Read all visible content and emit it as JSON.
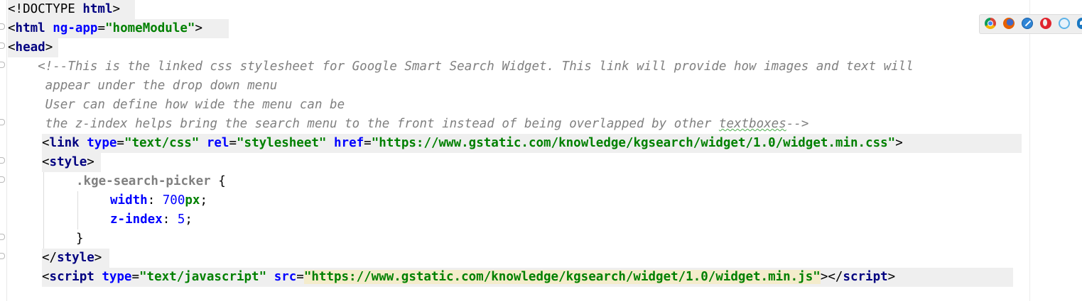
{
  "editor": {
    "lines": [
      {
        "segments": [
          {
            "t": "<!DOCTYPE ",
            "c": "doc"
          },
          {
            "t": "html",
            "c": "doc-kw"
          },
          {
            "t": ">",
            "c": "doc"
          }
        ]
      },
      {
        "segments": [
          {
            "t": "<",
            "c": "punc"
          },
          {
            "t": "html",
            "c": "name"
          },
          {
            "t": " ",
            "c": "punc"
          },
          {
            "t": "ng-app",
            "c": "attr"
          },
          {
            "t": "=",
            "c": "punc"
          },
          {
            "t": "\"homeModule\"",
            "c": "val"
          },
          {
            "t": ">",
            "c": "punc"
          }
        ]
      },
      {
        "segments": [
          {
            "t": "<",
            "c": "punc"
          },
          {
            "t": "head",
            "c": "name"
          },
          {
            "t": ">",
            "c": "punc"
          }
        ]
      },
      {
        "segments": [
          {
            "t": "    <!--This is the linked css stylesheet for Google Smart Search Widget. This link will provide how images and text will",
            "c": "comment"
          }
        ]
      },
      {
        "segments": [
          {
            "t": "     appear under the drop down menu",
            "c": "comment"
          }
        ]
      },
      {
        "segments": [
          {
            "t": "     User can define how wide the menu can be",
            "c": "comment"
          }
        ]
      },
      {
        "segments": [
          {
            "t": "     the z-index helps bring the search menu to the front instead of being overlapped by other ",
            "c": "comment"
          },
          {
            "t": "textboxes",
            "c": "comment-sq"
          },
          {
            "t": "-->",
            "c": "comment"
          }
        ]
      },
      {
        "segments": [
          {
            "t": "<",
            "c": "punc"
          },
          {
            "t": "link",
            "c": "name"
          },
          {
            "t": " ",
            "c": "punc"
          },
          {
            "t": "type",
            "c": "attr"
          },
          {
            "t": "=",
            "c": "punc"
          },
          {
            "t": "\"text/css\"",
            "c": "val"
          },
          {
            "t": " ",
            "c": "punc"
          },
          {
            "t": "rel",
            "c": "attr"
          },
          {
            "t": "=",
            "c": "punc"
          },
          {
            "t": "\"stylesheet\"",
            "c": "val"
          },
          {
            "t": " ",
            "c": "punc"
          },
          {
            "t": "href",
            "c": "attr"
          },
          {
            "t": "=",
            "c": "punc"
          },
          {
            "t": "\"https://www.gstatic.com/knowledge/kgsearch/widget/1.0/widget.min.css\"",
            "c": "val"
          },
          {
            "t": ">",
            "c": "punc"
          }
        ]
      },
      {
        "segments": [
          {
            "t": "<",
            "c": "punc"
          },
          {
            "t": "style",
            "c": "name"
          },
          {
            "t": ">",
            "c": "punc"
          }
        ]
      },
      {
        "segments": [
          {
            "t": ".kge-search-picker",
            "c": "css-sel"
          },
          {
            "t": " {",
            "c": "punc"
          }
        ]
      },
      {
        "segments": [
          {
            "t": "width",
            "c": "css-prop"
          },
          {
            "t": ": ",
            "c": "punc"
          },
          {
            "t": "700",
            "c": "css-num"
          },
          {
            "t": "px",
            "c": "css-unit"
          },
          {
            "t": ";",
            "c": "punc"
          }
        ]
      },
      {
        "segments": [
          {
            "t": "z-index",
            "c": "css-prop"
          },
          {
            "t": ": ",
            "c": "punc"
          },
          {
            "t": "5",
            "c": "css-num"
          },
          {
            "t": ";",
            "c": "punc"
          }
        ]
      },
      {
        "segments": [
          {
            "t": "}",
            "c": "punc"
          }
        ]
      },
      {
        "segments": [
          {
            "t": "</",
            "c": "punc"
          },
          {
            "t": "style",
            "c": "name"
          },
          {
            "t": ">",
            "c": "punc"
          }
        ]
      },
      {
        "segments": [
          {
            "t": "<",
            "c": "punc"
          },
          {
            "t": "script",
            "c": "name"
          },
          {
            "t": " ",
            "c": "punc"
          },
          {
            "t": "type",
            "c": "attr"
          },
          {
            "t": "=",
            "c": "punc"
          },
          {
            "t": "\"text/javascript\"",
            "c": "val"
          },
          {
            "t": " ",
            "c": "punc"
          },
          {
            "t": "src",
            "c": "attr"
          },
          {
            "t": "=",
            "c": "punc"
          },
          {
            "t": "\"https://www.gstatic.com/knowledge/kgsearch/widget/1.0/widget.min.js\"",
            "c": "val-hl"
          },
          {
            "t": "></",
            "c": "punc"
          },
          {
            "t": "script",
            "c": "name"
          },
          {
            "t": ">",
            "c": "punc"
          }
        ]
      }
    ]
  },
  "browser_icons": [
    "chrome-icon",
    "firefox-icon",
    "safari-icon",
    "opera-icon",
    "ie-icon",
    "edge-icon"
  ]
}
